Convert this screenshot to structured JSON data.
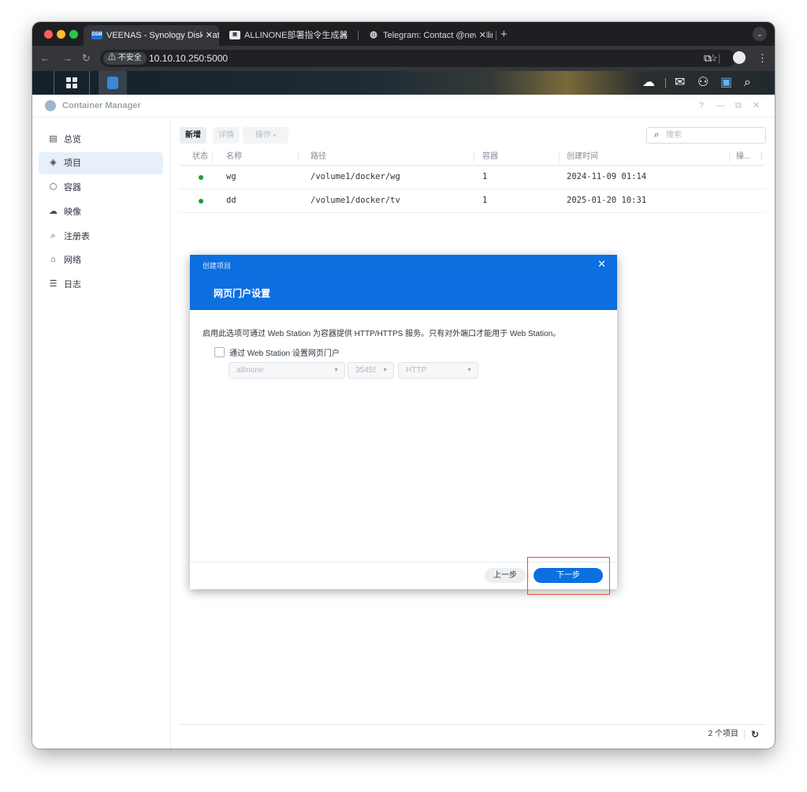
{
  "browser": {
    "tabs": [
      {
        "title": "VEENAS - Synology DiskStati",
        "favicon": "DSM"
      },
      {
        "title": "ALLINONE部署指令生成器",
        "favicon": ""
      },
      {
        "title": "Telegram: Contact @newallin",
        "favicon": ""
      }
    ],
    "address": {
      "security_label": "不安全",
      "url": "10.10.10.250:5000"
    }
  },
  "app": {
    "title": "Container Manager",
    "window_controls": {
      "help": "?",
      "minimize": "—",
      "restore": "⧉",
      "close": "✕"
    }
  },
  "sidebar": {
    "items": [
      {
        "label": "总览",
        "icon": "overview-icon",
        "glyph": "▤"
      },
      {
        "label": "项目",
        "icon": "project-icon",
        "glyph": "◈",
        "selected": true
      },
      {
        "label": "容器",
        "icon": "container-icon",
        "glyph": "⬡"
      },
      {
        "label": "映像",
        "icon": "image-icon",
        "glyph": "☁"
      },
      {
        "label": "注册表",
        "icon": "registry-icon",
        "glyph": "⌕"
      },
      {
        "label": "网络",
        "icon": "network-icon",
        "glyph": "⌂"
      },
      {
        "label": "日志",
        "icon": "log-icon",
        "glyph": "☰"
      }
    ]
  },
  "toolbar": {
    "new_label": "新增",
    "details_label": "详情",
    "action_label": "操作",
    "search_placeholder": "搜索"
  },
  "table": {
    "headers": [
      "状态",
      "名称",
      "路径",
      "容器",
      "创建时间",
      "操..."
    ],
    "rows": [
      {
        "name": "wg",
        "path": "/volume1/docker/wg",
        "containers": "1",
        "created": "2024-11-09 01:14"
      },
      {
        "name": "dd",
        "path": "/volume1/docker/tv",
        "containers": "1",
        "created": "2025-01-20 10:31"
      }
    ],
    "status_color": "#1e9e2e"
  },
  "footer": {
    "count_label": "2 个项目"
  },
  "dialog": {
    "breadcrumb": "创建项目",
    "title": "网页门户设置",
    "description": "启用此选项可通过 Web Station 为容器提供 HTTP/HTTPS 服务。只有对外端口才能用于 Web Station。",
    "checkbox_label": "通过 Web Station 设置网页门户",
    "checkbox_checked": false,
    "selects": {
      "service": "allinone",
      "port": "35455",
      "protocol": "HTTP"
    },
    "prev_label": "上一步",
    "next_label": "下一步",
    "accent_color": "#0b6fe0"
  }
}
